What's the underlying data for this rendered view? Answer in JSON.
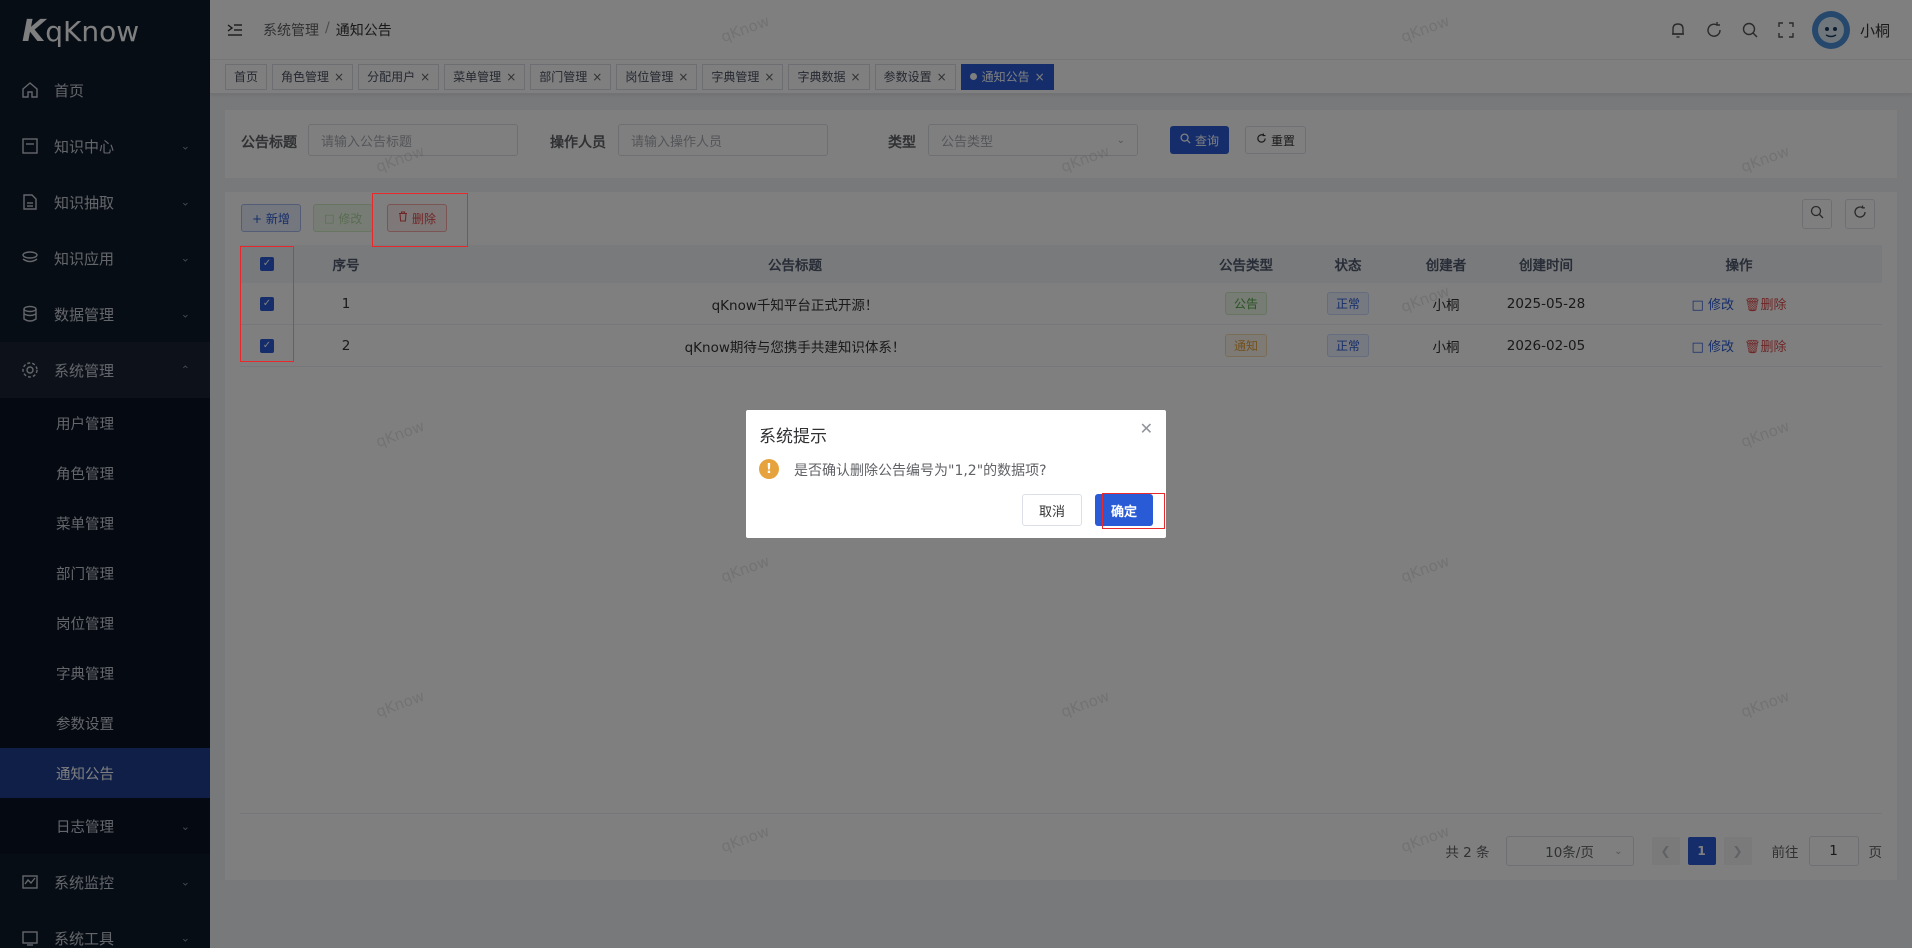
{
  "app": {
    "logo_mark": "K",
    "logo_text": "qKnow",
    "username": "小桐"
  },
  "sidebar": {
    "items": [
      {
        "label": "首页",
        "icon": "home-icon"
      },
      {
        "label": "知识中心",
        "icon": "book-icon"
      },
      {
        "label": "知识抽取",
        "icon": "document-icon"
      },
      {
        "label": "知识应用",
        "icon": "layers-icon"
      },
      {
        "label": "数据管理",
        "icon": "database-icon"
      },
      {
        "label": "系统管理",
        "icon": "gear-icon"
      },
      {
        "label": "系统监控",
        "icon": "monitor-icon"
      },
      {
        "label": "系统工具",
        "icon": "tools-icon"
      }
    ],
    "sub_items": [
      {
        "label": "用户管理"
      },
      {
        "label": "角色管理"
      },
      {
        "label": "菜单管理"
      },
      {
        "label": "部门管理"
      },
      {
        "label": "岗位管理"
      },
      {
        "label": "字典管理"
      },
      {
        "label": "参数设置"
      },
      {
        "label": "通知公告"
      },
      {
        "label": "日志管理"
      }
    ]
  },
  "header": {
    "breadcrumb": [
      "系统管理",
      "/",
      "通知公告"
    ]
  },
  "tags": [
    "首页",
    "角色管理",
    "分配用户",
    "菜单管理",
    "部门管理",
    "岗位管理",
    "字典管理",
    "字典数据",
    "参数设置",
    "通知公告"
  ],
  "search": {
    "title_label": "公告标题",
    "title_placeholder": "请输入公告标题",
    "operator_label": "操作人员",
    "operator_placeholder": "请输入操作人员",
    "type_label": "类型",
    "type_placeholder": "公告类型",
    "query_label": "查询",
    "reset_label": "重置"
  },
  "toolbar": {
    "add_label": "+ 新增",
    "edit_label": "修改",
    "delete_label": "删除"
  },
  "table": {
    "headers": [
      "序号",
      "公告标题",
      "公告类型",
      "状态",
      "创建者",
      "创建时间",
      "操作"
    ],
    "rows": [
      {
        "idx": "1",
        "title": "qKnow千知平台正式开源！",
        "type": "公告",
        "status": "正常",
        "creator": "小桐",
        "time": "2025-05-28",
        "edit": "修改",
        "del": "删除"
      },
      {
        "idx": "2",
        "title": "qKnow期待与您携手共建知识体系！",
        "type": "通知",
        "status": "正常",
        "creator": "小桐",
        "time": "2026-02-05",
        "edit": "修改",
        "del": "删除"
      }
    ]
  },
  "pager": {
    "total": "共 2 条",
    "size": "10条/页",
    "current": "1",
    "goto_label": "前往",
    "goto_value": "1",
    "page_suffix": "页"
  },
  "dialog": {
    "title": "系统提示",
    "message": "是否确认删除公告编号为\"1,2\"的数据项?",
    "cancel": "取消",
    "ok": "确定"
  },
  "watermark": "qKnow",
  "colors": {
    "primary": "#2a5bd7",
    "sidebar_bg": "#0f1a2b",
    "danger": "#e04c4c",
    "highlight": "#e8282b"
  }
}
